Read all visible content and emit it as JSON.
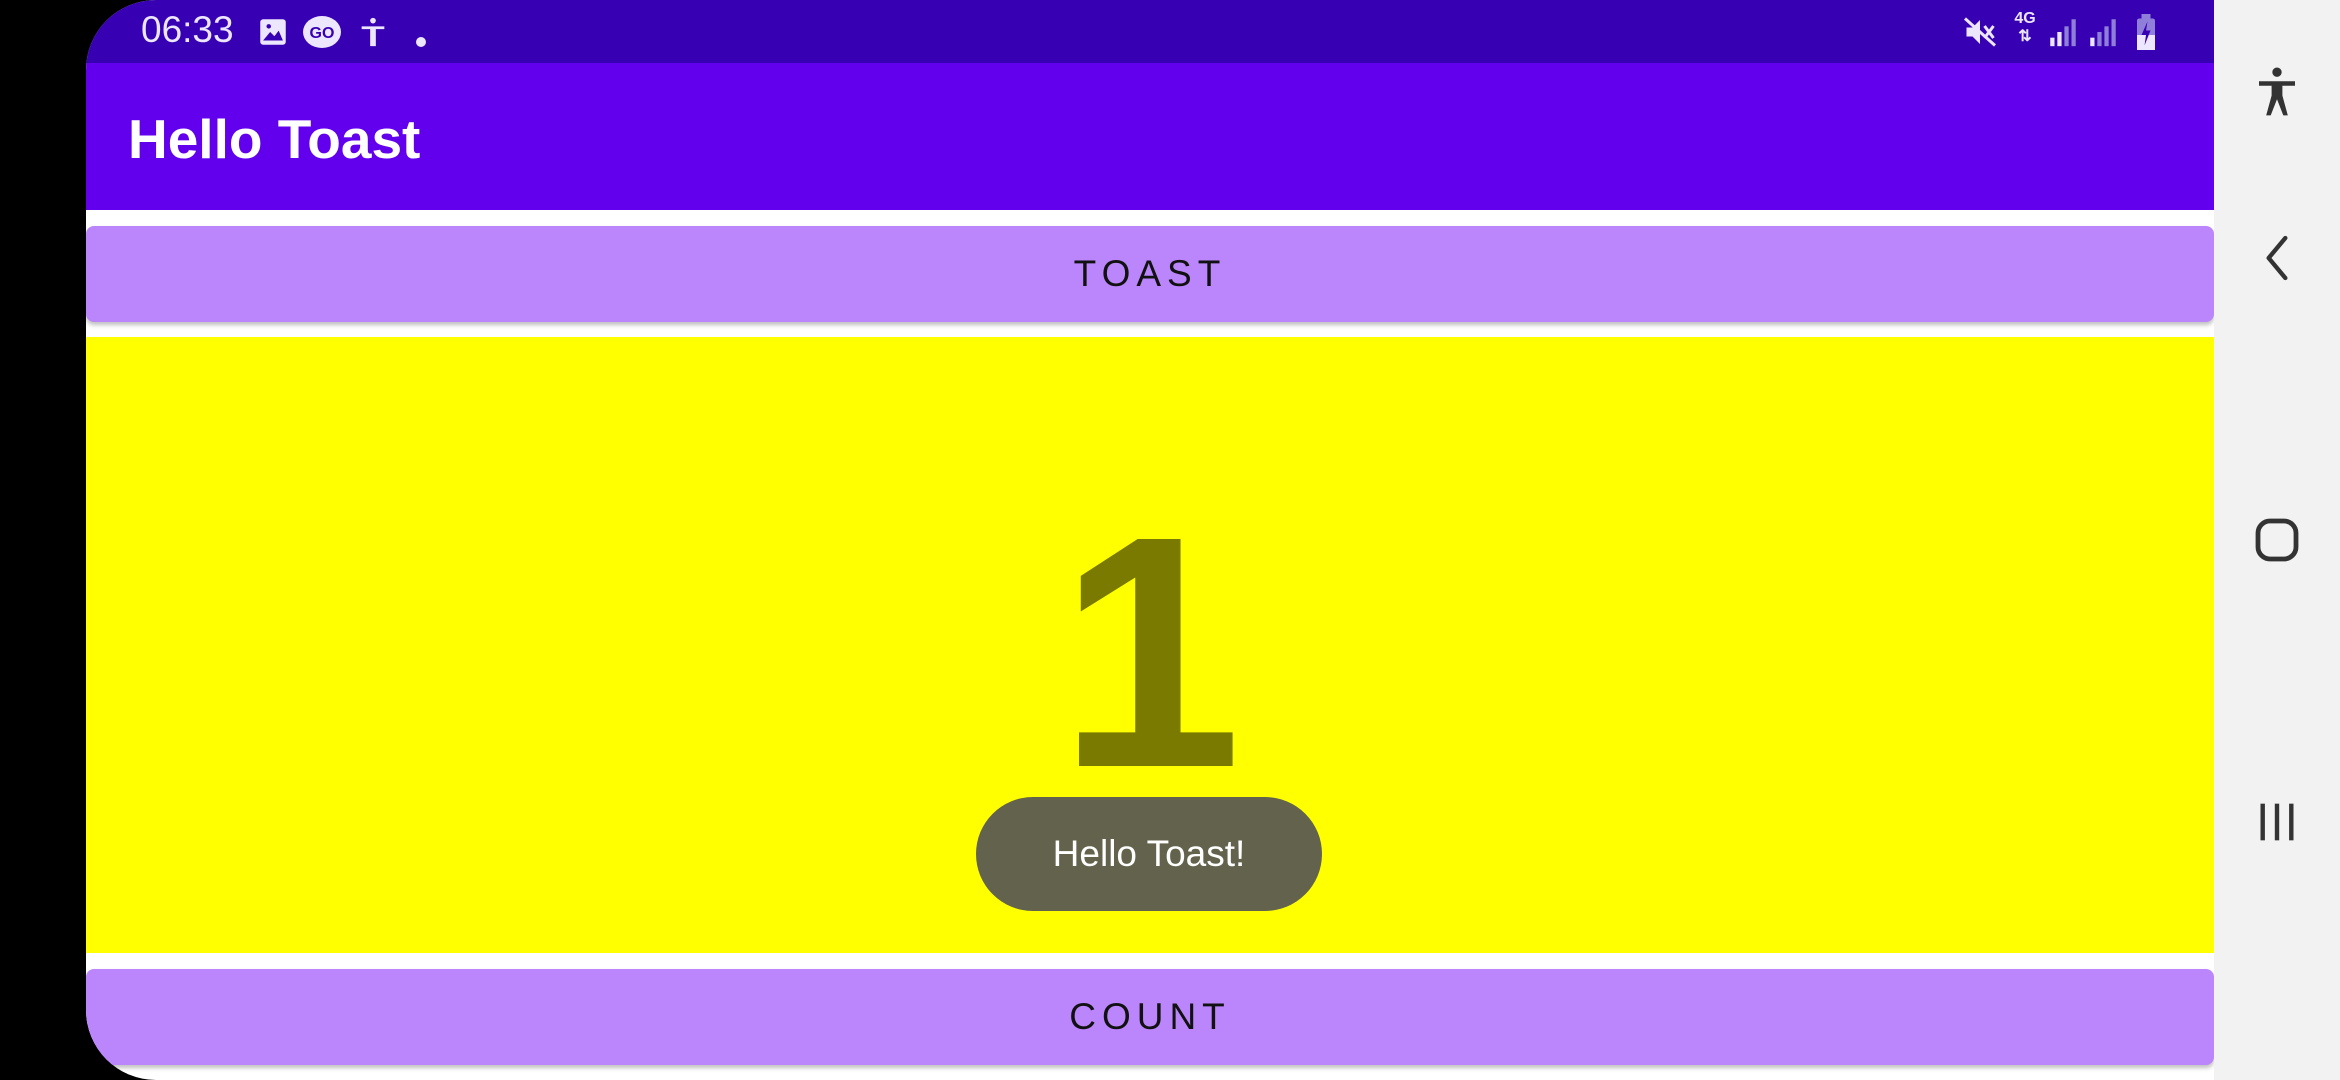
{
  "status_bar": {
    "time": "06:33",
    "background": "#3700b3",
    "left_icons": [
      "image-icon",
      "go-badge-icon",
      "accessibility-icon",
      "dot-icon"
    ],
    "right_icons": [
      "vibrate-mute-icon",
      "network-4g-icon",
      "signal-icon",
      "signal-icon-2",
      "battery-charging-icon"
    ],
    "network_label": "4G"
  },
  "app_bar": {
    "title": "Hello Toast",
    "background": "#6200ee"
  },
  "buttons": {
    "toast_label": "TOAST",
    "count_label": "COUNT",
    "color": "#bb86fc"
  },
  "count": {
    "value": "1",
    "background": "#ffff00",
    "text_color": "#7a7a00"
  },
  "toast": {
    "message": "Hello Toast!"
  },
  "nav_bar": {
    "items": [
      "accessibility-icon",
      "back-icon",
      "home-icon",
      "recents-icon"
    ]
  }
}
